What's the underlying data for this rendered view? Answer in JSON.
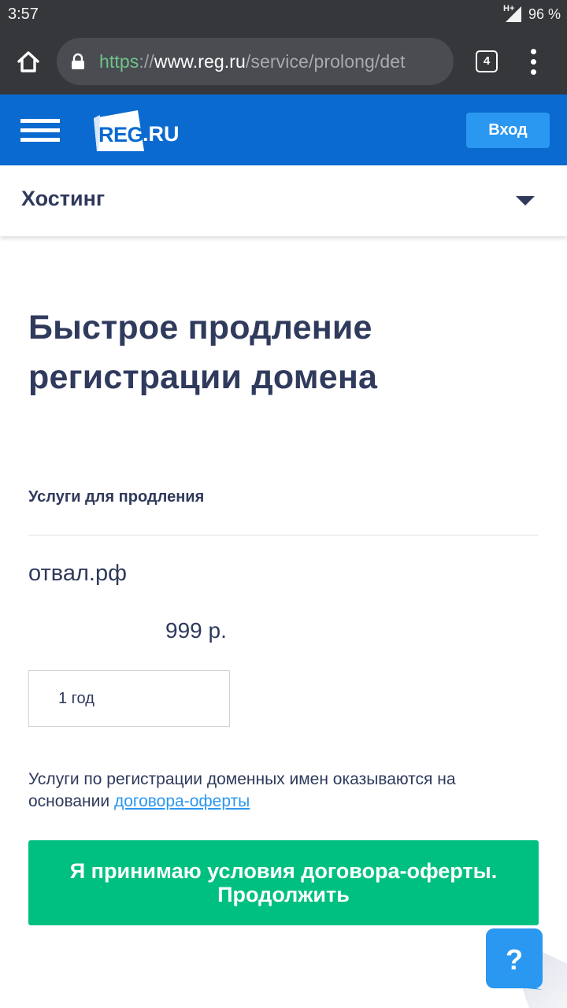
{
  "status_bar": {
    "time": "3:57",
    "network": "H+",
    "battery": "96 %"
  },
  "browser": {
    "url": {
      "scheme": "https",
      "separator": "://",
      "host": "www.reg.ru",
      "path": "/service/prolong/det"
    },
    "tab_count": "4",
    "icons": {
      "home": "home-icon",
      "lock": "lock-icon",
      "menu": "more-vert-icon"
    }
  },
  "header": {
    "logo_reg": "REG",
    "logo_ru": ".RU",
    "login_label": "Вход",
    "colors": {
      "header_bg": "#0a6ad0",
      "login_bg": "#2a97f0"
    }
  },
  "section": {
    "label": "Хостинг"
  },
  "main": {
    "title_line1": "Быстрое продление",
    "title_line2": "регистрации домена",
    "services_heading": "Услуги для продления",
    "domain": "отвал.рф",
    "price": "999 р.",
    "period": "1 год",
    "terms_text": "Услуги по регистрации доменных имен оказываются на основании ",
    "terms_link": "договора-оферты",
    "accept_line1": "Я принимаю условия договора-оферты.",
    "accept_line2": "Продолжить",
    "help_label": "?",
    "colors": {
      "text": "#2f3a5c",
      "accept_bg": "#00c081",
      "link": "#2a97f0"
    }
  }
}
